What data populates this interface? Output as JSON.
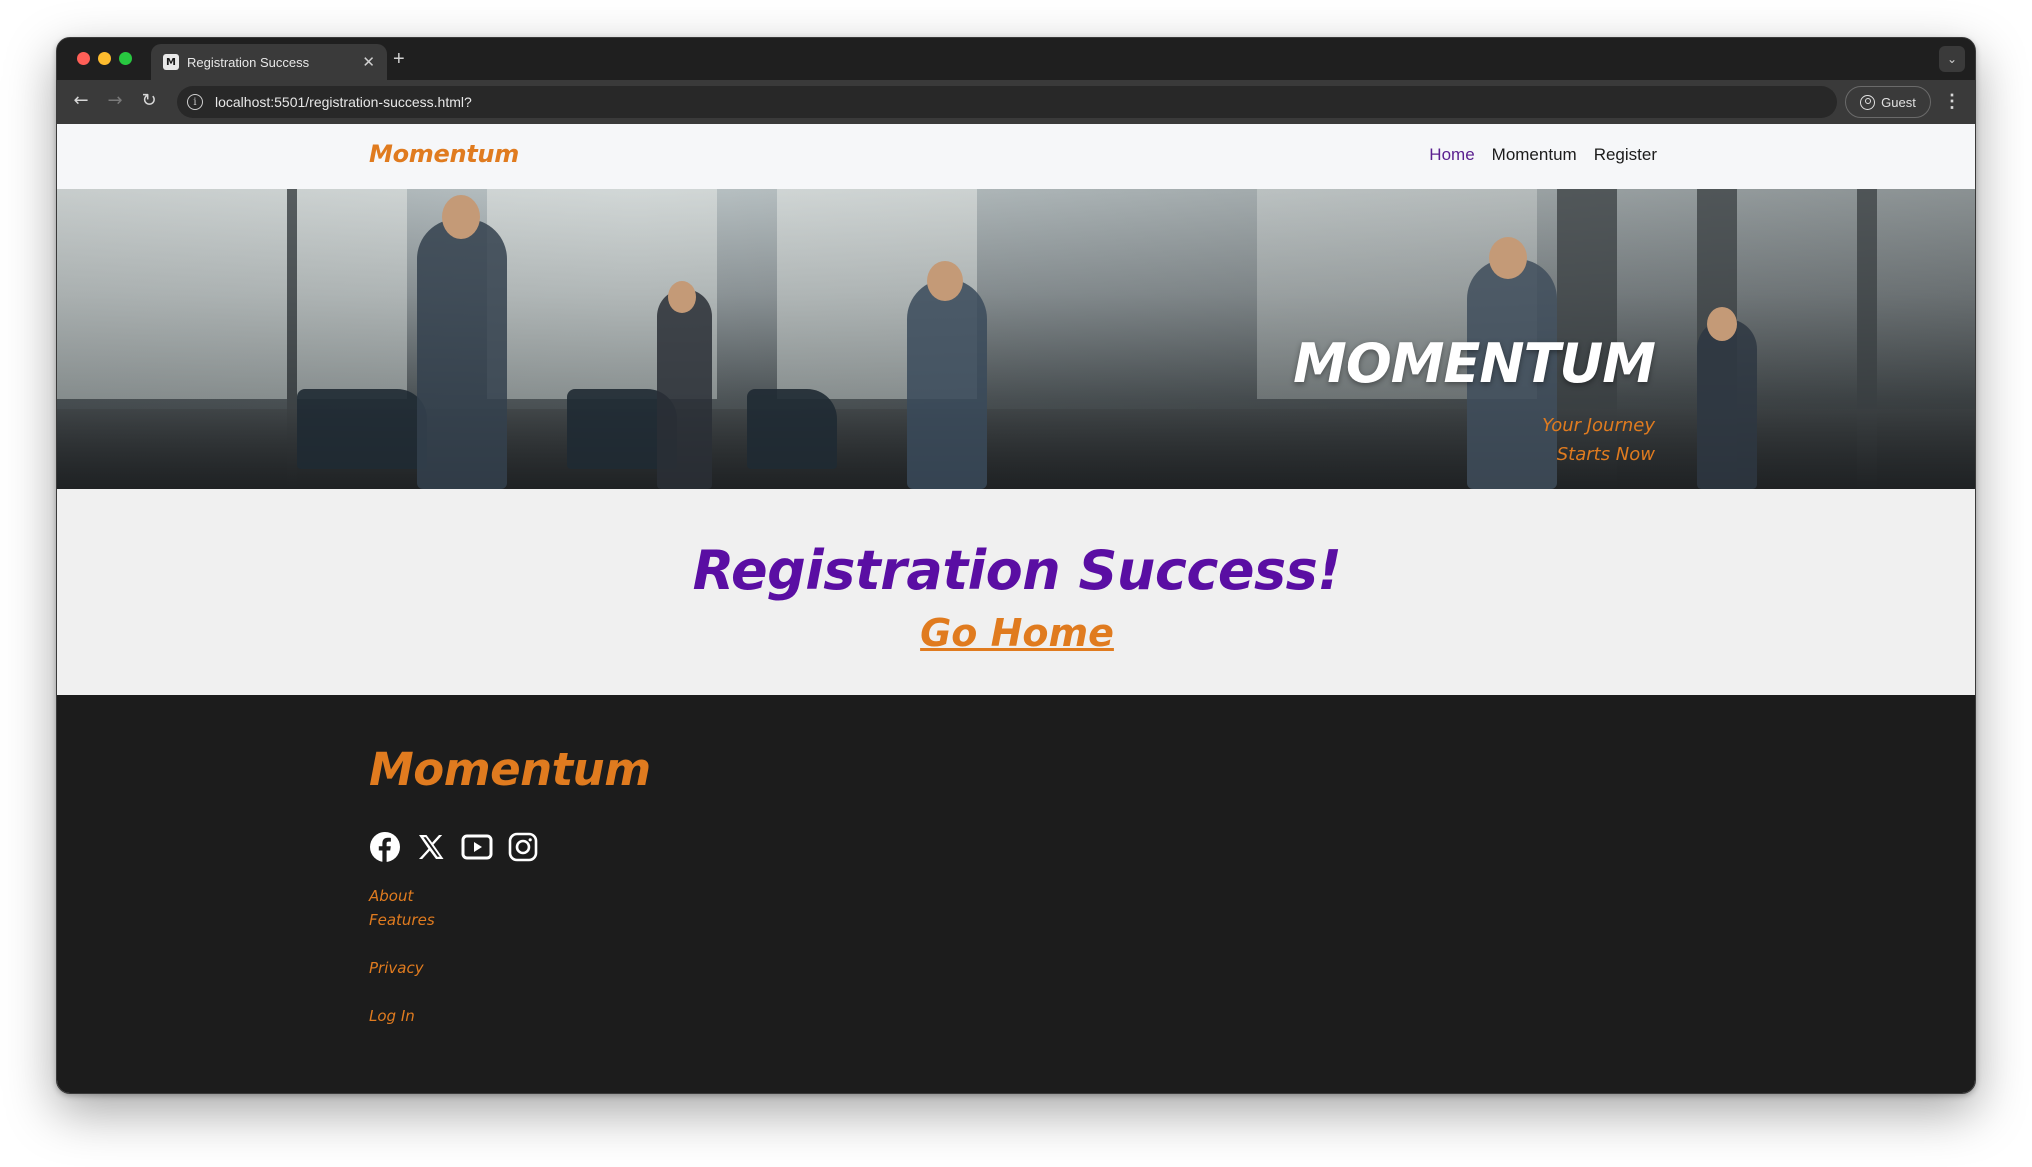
{
  "browser": {
    "tab_title": "Registration Success",
    "tab_favicon_text": "M",
    "url": "localhost:5501/registration-success.html?",
    "profile_label": "Guest"
  },
  "nav": {
    "brand": "Momentum",
    "links": [
      "Home",
      "Momentum",
      "Register"
    ],
    "active_link": "Home"
  },
  "hero": {
    "title": "MOMENTUM",
    "tagline": "Your Journey Starts Now"
  },
  "main": {
    "heading": "Registration Success!",
    "link": "Go Home"
  },
  "footer": {
    "brand": "Momentum",
    "social_icons": [
      "facebook-icon",
      "x-icon",
      "youtube-icon",
      "instagram-icon"
    ],
    "links": [
      "About",
      "Features",
      "Privacy",
      "Log In"
    ]
  },
  "colors": {
    "accent_orange": "#e07b1f",
    "accent_purple": "#5a0ea3",
    "footer_bg": "#1c1c1c"
  }
}
